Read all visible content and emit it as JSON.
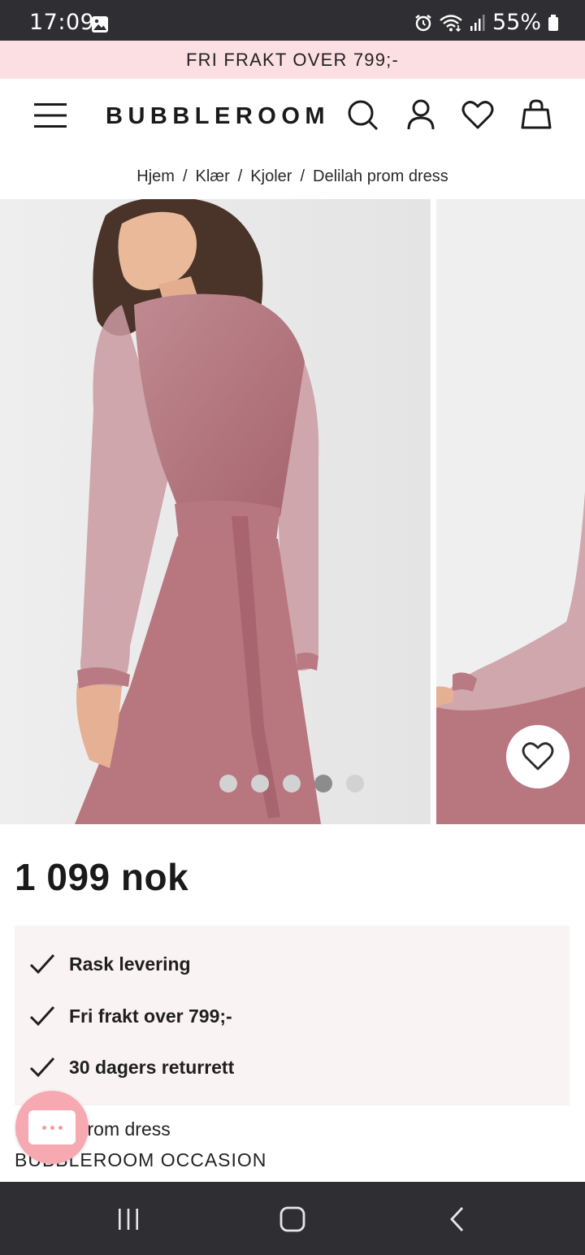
{
  "status_bar": {
    "time": "17:09",
    "battery": "55%",
    "icons": [
      "image-icon",
      "alarm-icon",
      "wifi-icon",
      "signal-icon",
      "battery-icon"
    ]
  },
  "promo": {
    "text": "FRI FRAKT OVER 799;-"
  },
  "header": {
    "logo": "BUBBLEROOM",
    "icons": [
      "menu-icon",
      "search-icon",
      "account-icon",
      "wishlist-icon",
      "bag-icon"
    ]
  },
  "breadcrumb": {
    "items": [
      "Hjem",
      "Klær",
      "Kjoler",
      "Delilah prom dress"
    ],
    "separator": "/"
  },
  "gallery": {
    "slide_count": 5,
    "active_index": 3,
    "dress_color": "#b5767f"
  },
  "product": {
    "price": "1 099 nok",
    "name": "Delilah prom dress",
    "brand": "BUBBLEROOM OCCASION"
  },
  "usps": [
    "Rask levering",
    "Fri frakt over 799;-",
    "30 dagers returrett"
  ],
  "colors": {
    "promo_bg": "#fcdfe2",
    "usp_bg": "#faf3f3",
    "chat_bg": "#f7a9b2",
    "system_bar": "#2f2f33"
  },
  "nav_bar": {
    "icons": [
      "recent-apps-icon",
      "home-icon",
      "back-icon"
    ]
  }
}
